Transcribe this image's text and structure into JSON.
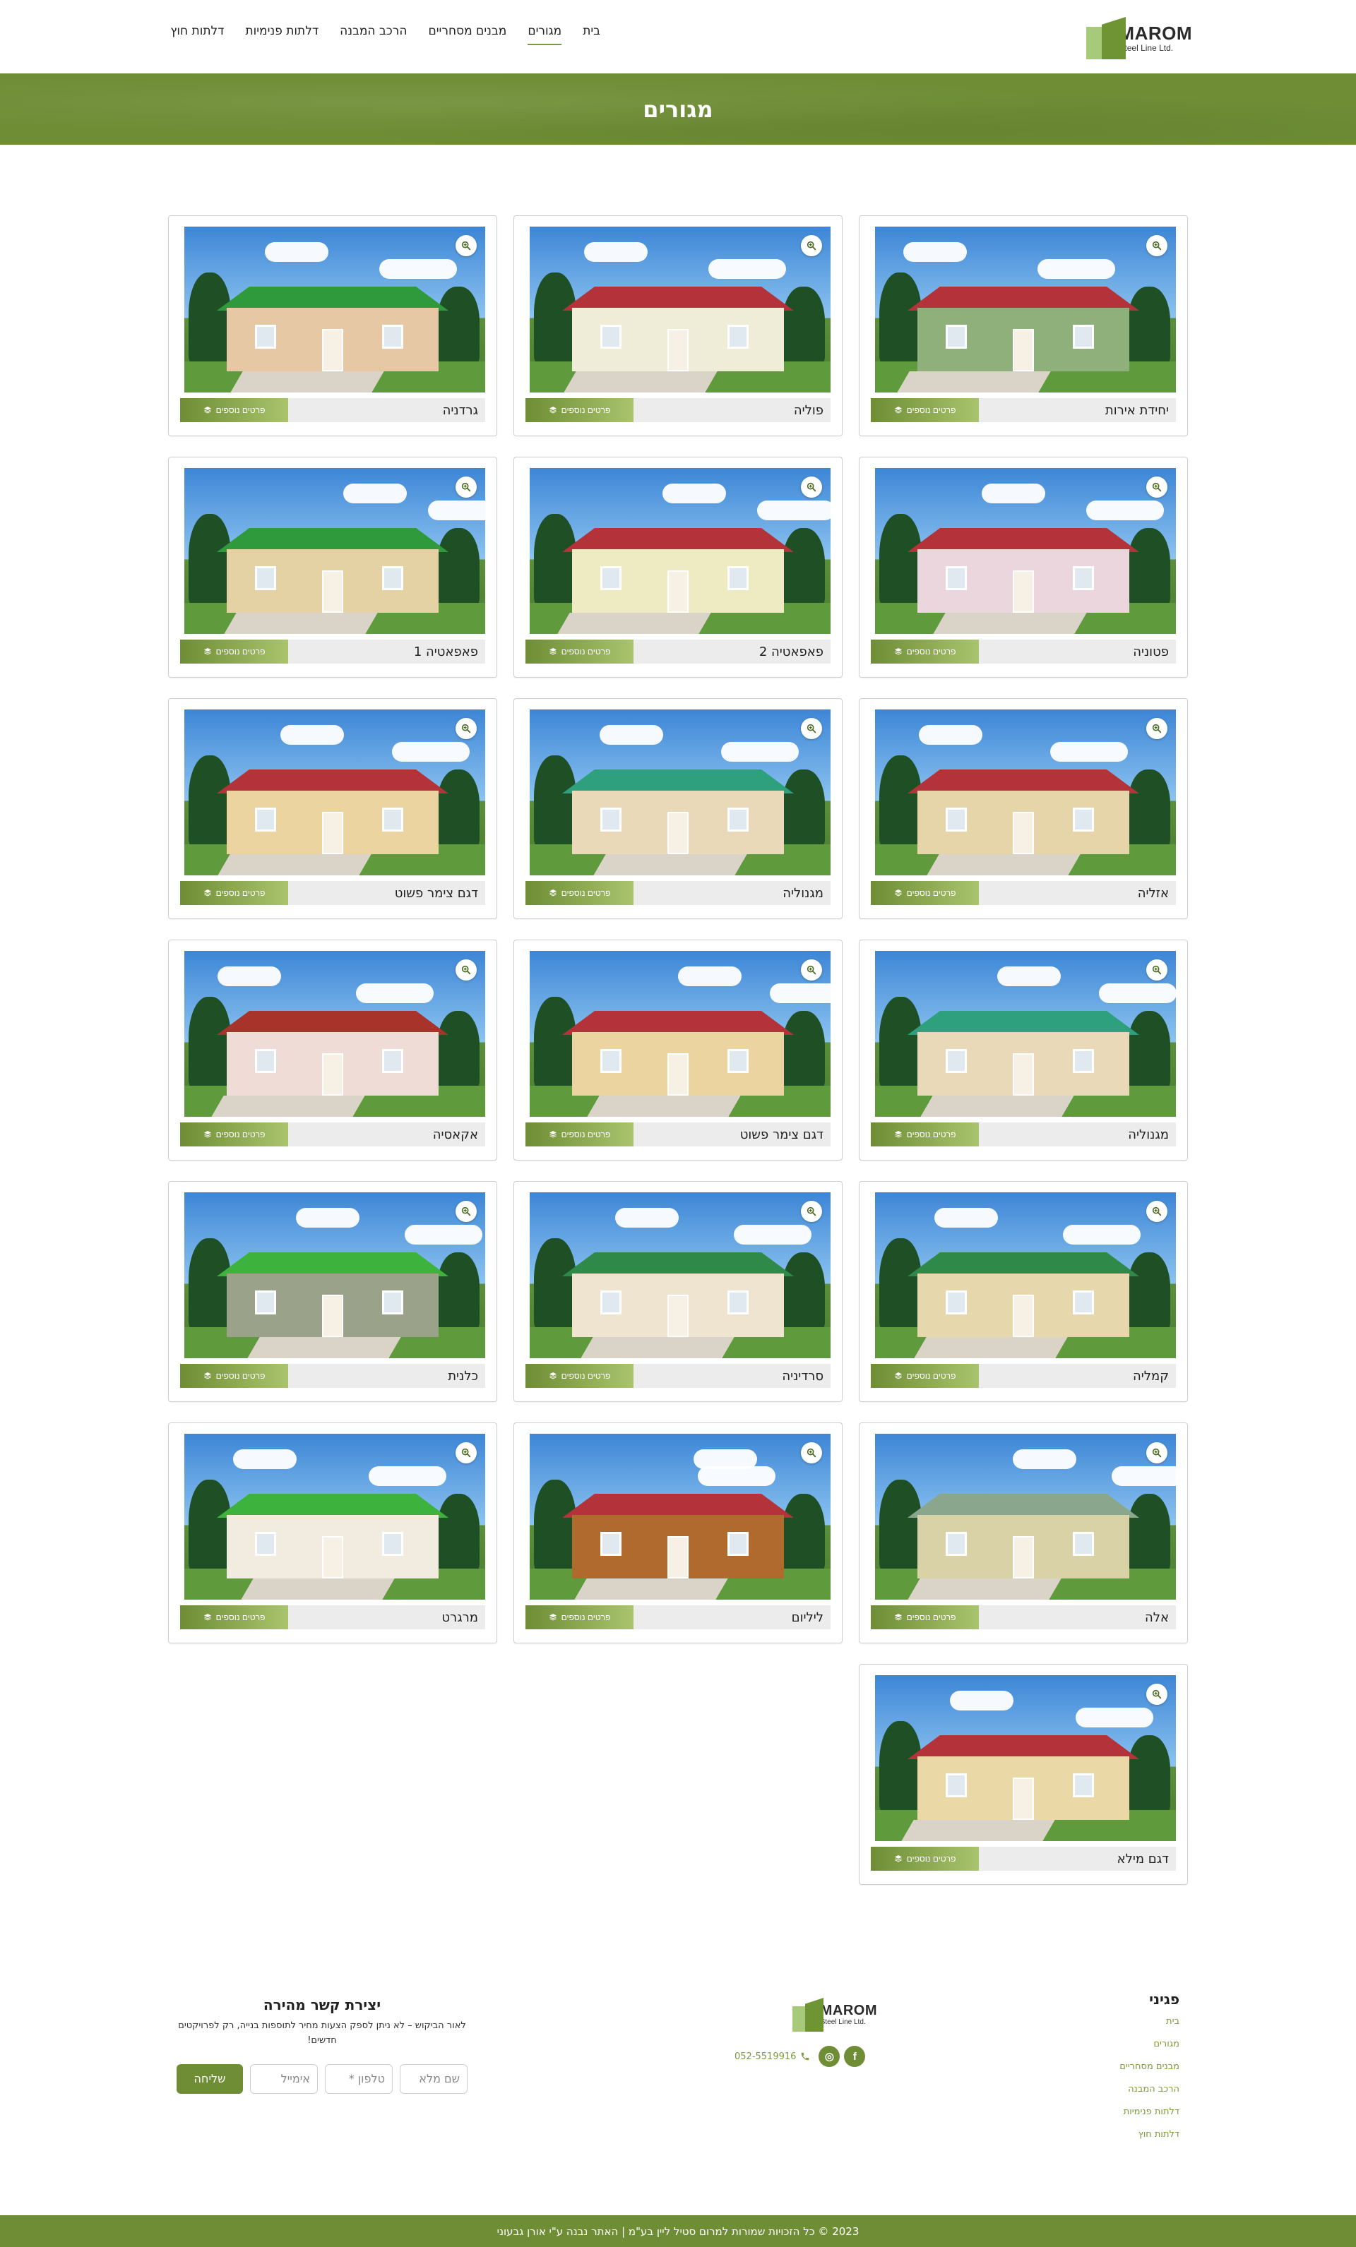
{
  "logo": {
    "name": "MAROM",
    "tagline": "Steel Line Ltd."
  },
  "nav": {
    "items": [
      {
        "label": "בית",
        "active": false
      },
      {
        "label": "מגורים",
        "active": true
      },
      {
        "label": "מבנים מסחריים",
        "active": false
      },
      {
        "label": "הרכב המבנה",
        "active": false
      },
      {
        "label": "דלתות פנימיות",
        "active": false
      },
      {
        "label": "דלתות חוץ",
        "active": false
      }
    ]
  },
  "banner": {
    "title": "מגורים"
  },
  "cards": [
    {
      "name": "יחידת אירות",
      "roof": "#b4333a",
      "wall": "#8fb07a"
    },
    {
      "name": "פוליה",
      "roof": "#b4333a",
      "wall": "#efecd8"
    },
    {
      "name": "גרדניה",
      "roof": "#2f9a3c",
      "wall": "#e6c9a4"
    },
    {
      "name": "פטוניה",
      "roof": "#b4333a",
      "wall": "#ead6dc"
    },
    {
      "name": "פאפאטיה 2",
      "roof": "#b4333a",
      "wall": "#eeeac2"
    },
    {
      "name": "פאפאטיה 1",
      "roof": "#2f9a3c",
      "wall": "#e4d2a5"
    },
    {
      "name": "אזליה",
      "roof": "#b4333a",
      "wall": "#e6d5a8"
    },
    {
      "name": "מגנוליה",
      "roof": "#2fa07e",
      "wall": "#ead9b8"
    },
    {
      "name": "דגם צימר פשוט",
      "roof": "#b4333a",
      "wall": "#ecd4a0"
    },
    {
      "name": "מגנוליה",
      "roof": "#2fa07e",
      "wall": "#ead9b8"
    },
    {
      "name": "דגם צימר פשוט",
      "roof": "#b4333a",
      "wall": "#ecd4a0"
    },
    {
      "name": "אקאסיה",
      "roof": "#a8332b",
      "wall": "#f0dcd6"
    },
    {
      "name": "קמליה",
      "roof": "#2f8a4a",
      "wall": "#e7d7ad"
    },
    {
      "name": "סרדיניה",
      "roof": "#2f8a4a",
      "wall": "#efe4cf"
    },
    {
      "name": "כלנית",
      "roof": "#3db23d",
      "wall": "#9aa38a"
    },
    {
      "name": "אלה",
      "roof": "#8aa78d",
      "wall": "#d8d2a6"
    },
    {
      "name": "ליליום",
      "roof": "#b4333a",
      "wall": "#b06a2e"
    },
    {
      "name": "מרגרט",
      "roof": "#3db23d",
      "wall": "#f1ebe0"
    },
    {
      "name": "דגם מילא",
      "roof": "#b4333a",
      "wall": "#ead8a6"
    }
  ],
  "card_button_label": "פרטים נוספים",
  "footer": {
    "pages": {
      "title": "פגיני",
      "links": [
        "בית",
        "מגורים",
        "מבנים מסחריים",
        "הרכב המבנה",
        "דלתות פנימיות",
        "דלתות חוץ"
      ]
    },
    "phone": "052-5519916",
    "social": [
      {
        "icon": "facebook-icon",
        "glyph": "f"
      },
      {
        "icon": "instagram-icon",
        "glyph": "◎"
      }
    ],
    "form": {
      "title": "יצירת קשר מהירה",
      "note": "לאור הביקוש – לא ניתן לספק הצעות מחיר לתוספות בנייה, רק לפרויקטים חדשים!",
      "fields": [
        "שם מלא",
        "טלפון *",
        "אימייל"
      ],
      "submit": "שליחה"
    },
    "copyright": "2023 © כל הזכויות שמורות למרום סטיל ליין בע\"מ | האתר נבנה ע\"י אורן גבעוני"
  },
  "colors": {
    "brand": "#6e8d35",
    "brand_light": "#a9c46d"
  }
}
